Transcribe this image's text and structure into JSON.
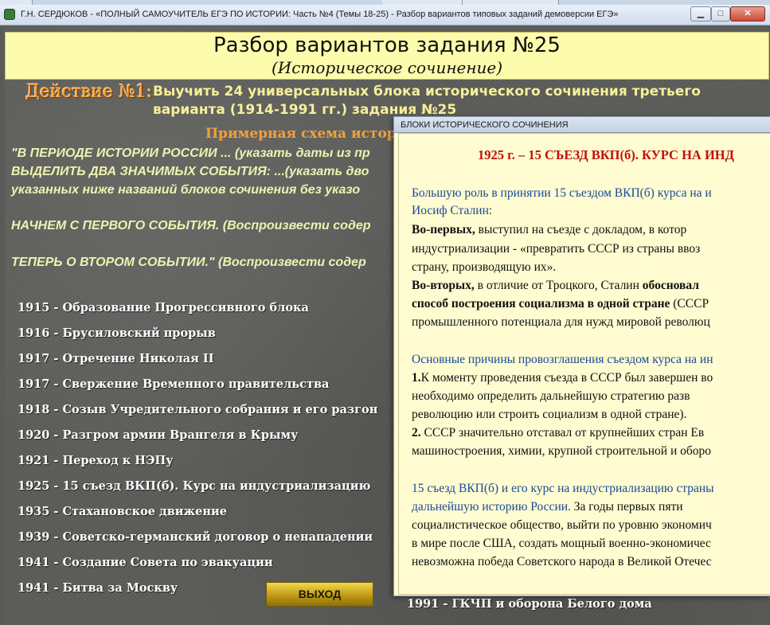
{
  "window": {
    "title": "Г.Н. СЕРДЮКОВ - «ПОЛНЫЙ САМОУЧИТЕЛЬ  ЕГЭ ПО ИСТОРИИ: Часть №4 (Темы 18-25) - Разбор вариантов типовых заданий демоверсии ЕГЭ»",
    "minimize": "▁",
    "maximize": "□",
    "close": "✕"
  },
  "header": {
    "title": "Разбор вариантов задания №25",
    "subtitle": "(Историческое сочинение)"
  },
  "action": {
    "label": "Действие №1:",
    "text_line1": "Выучить 24 универсальных блока исторического сочинения третьего",
    "text_line2": "варианта (1914-1991 гг.) задания №25"
  },
  "scheme_title": "Примерная схема истори",
  "scheme_lines": [
    "\"В ПЕРИОДЕ ИСТОРИИ РОССИИ ... (указать даты из пр",
    "ВЫДЕЛИТЬ ДВА ЗНАЧИМЫХ СОБЫТИЯ: ...(указать дво",
    "указанных ниже названий блоков сочинения без указо",
    "НАЧНЕМ С ПЕРВОГО СОБЫТИЯ. (Воспроизвести содер",
    "ТЕПЕРЬ О ВТОРОМ СОБЫТИИ.\" (Воспроизвести содер"
  ],
  "events": [
    "1915 - Образование Прогрессивного блока",
    "1916 - Брусиловский прорыв",
    "1917 - Отречение Николая II",
    "1917 - Свержение Временного правительства",
    "1918 - Созыв Учредительного собрания и его разгон",
    "1920 - Разгром армии Врангеля в Крыму",
    "1921 - Переход к НЭПу",
    "1925 - 15 съезд ВКП(б). Курс на индустриализацию",
    "1935 - Стахановское движение",
    "1939 - Советско-германский договор о ненападении",
    "1941 - Создание Совета по эвакуации",
    "1941 - Битва за Москву"
  ],
  "event_bottom": "1991 - ГКЧП и оборона Белого дома",
  "exit_button": "ВЫХОД",
  "popup": {
    "title": "БЛОКИ ИСТОРИЧЕСКОГО СОЧИНЕНИЯ",
    "heading": "1925 г. – 15 СЪЕЗД ВКП(б). КУРС НА ИНД",
    "l1": "Большую роль в принятии 15 съездом ВКП(б) курса на и",
    "l2": "Иосиф Сталин:",
    "l3_b": "Во-первых,",
    "l3": " выступил на съезде с докладом, в котор",
    "l4": "индустриализации - «превратить СССР из страны ввоз",
    "l5": "страну, производящую их».",
    "l6_b": "Во-вторых,",
    "l6": " в отличие от Троцкого, Сталин ",
    "l6_b2": "обосновал",
    "l7_b": "способ построения социализма в одной стране",
    "l7": " (СССР",
    "l8": "промышленного потенциала для нужд мировой революц",
    "l9": "Основные причины провозглашения съездом курса на ин",
    "l10_b": "1.",
    "l10": "К моменту проведения съезда в СССР был завершен во",
    "l11": "необходимо определить дальнейшую стратегию разв",
    "l12": "революцию или строить социализм в одной стране).",
    "l13_b": "2.",
    "l13": " СССР значительно отставал от крупнейших стран Ев",
    "l14": "машиностроения, химии, крупной строительной и оборо",
    "l15": "15 съезд ВКП(б) и его курс на индустриализацию страны",
    "l16_blue": "дальнейшую историю России.",
    "l16": " За годы первых пяти",
    "l17": "социалистическое общество, выйти по уровню экономич",
    "l18": "в мире после США, создать мощный военно-экономичес",
    "l19": "невозможна победа Советского народа в Великой Отечес"
  }
}
